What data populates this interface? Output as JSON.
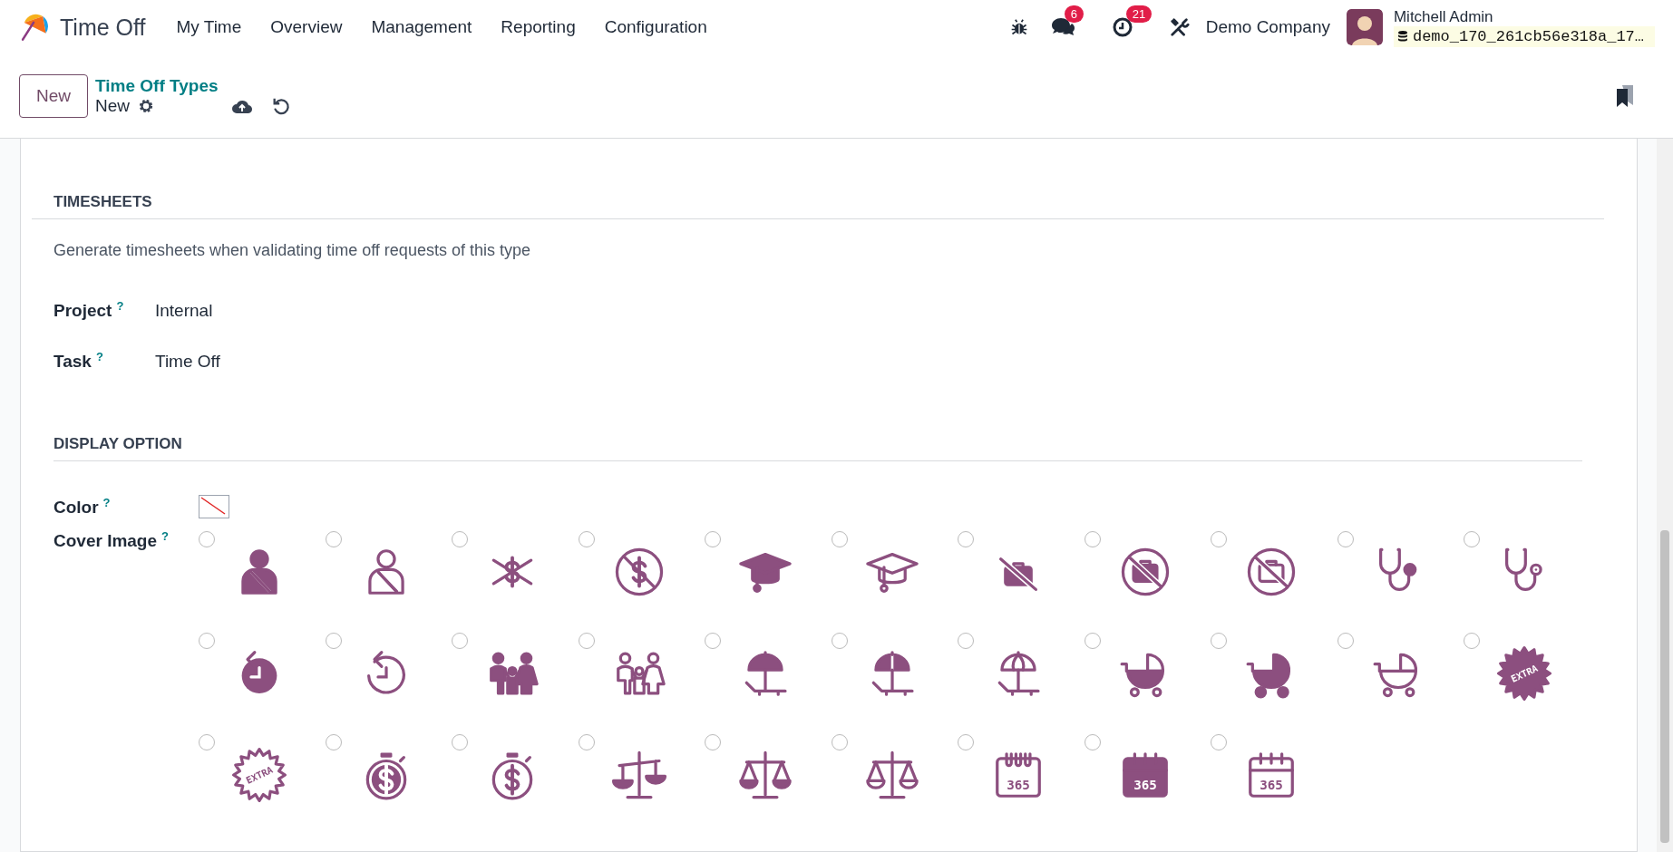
{
  "navbar": {
    "app_name": "Time Off",
    "menu": [
      {
        "label": "My Time"
      },
      {
        "label": "Overview"
      },
      {
        "label": "Management"
      },
      {
        "label": "Reporting"
      },
      {
        "label": "Configuration"
      }
    ],
    "messages_count": "6",
    "activities_count": "21",
    "company": "Demo Company",
    "user_name": "Mitchell Admin",
    "database": "demo_170_261cb56e318a_17…"
  },
  "control_panel": {
    "new_button": "New",
    "breadcrumb": "Time Off Types",
    "record": "New"
  },
  "timesheets": {
    "title": "TIMESHEETS",
    "description": "Generate timesheets when validating time off requests of this type",
    "fields": [
      {
        "label": "Project",
        "help": "?",
        "value": "Internal"
      },
      {
        "label": "Task",
        "help": "?",
        "value": "Time Off"
      }
    ]
  },
  "display_option": {
    "title": "DISPLAY OPTION",
    "color": {
      "label": "Color",
      "help": "?"
    },
    "cover_image": {
      "label": "Cover Image",
      "help": "?",
      "options": [
        {
          "kind": "armslingsolid",
          "selected": false
        },
        {
          "kind": "armslingoutline",
          "selected": false
        },
        {
          "kind": "nomoneysolid",
          "selected": false
        },
        {
          "kind": "nomoneycircle",
          "selected": false
        },
        {
          "kind": "gradcapsolid",
          "selected": false
        },
        {
          "kind": "gradcapoutline",
          "selected": false
        },
        {
          "kind": "nobriefcasesolid",
          "selected": false
        },
        {
          "kind": "nobriefcasecirclesolid",
          "selected": false
        },
        {
          "kind": "nobriefcasecircleoutline",
          "selected": false
        },
        {
          "kind": "stethoscopesolid",
          "selected": false
        },
        {
          "kind": "stethoscopeoutline",
          "selected": false
        },
        {
          "kind": "historysolid",
          "selected": false
        },
        {
          "kind": "historyoutline",
          "selected": false
        },
        {
          "kind": "familysolid",
          "selected": false
        },
        {
          "kind": "familyoutline",
          "selected": false
        },
        {
          "kind": "beachsolid",
          "selected": false
        },
        {
          "kind": "beachhalf",
          "selected": false
        },
        {
          "kind": "beachoutline",
          "selected": false
        },
        {
          "kind": "strollerhalf",
          "selected": false
        },
        {
          "kind": "strollersolid",
          "selected": false
        },
        {
          "kind": "strolleroutline",
          "selected": false
        },
        {
          "kind": "starburstsolid",
          "text": "EXTRA",
          "selected": false
        },
        {
          "kind": "starburstoutline",
          "text": "EXTRA",
          "selected": false
        },
        {
          "kind": "stopwatchsolid",
          "selected": false
        },
        {
          "kind": "stopwatchoutline",
          "selected": false
        },
        {
          "kind": "scaletilted",
          "selected": false
        },
        {
          "kind": "scalesolid",
          "selected": false
        },
        {
          "kind": "scaleoutline",
          "selected": false
        },
        {
          "kind": "calendarrings",
          "text": "365",
          "selected": false
        },
        {
          "kind": "calendarsolid",
          "text": "365",
          "selected": false
        },
        {
          "kind": "calendaroutline",
          "text": "365",
          "selected": false
        }
      ]
    }
  }
}
